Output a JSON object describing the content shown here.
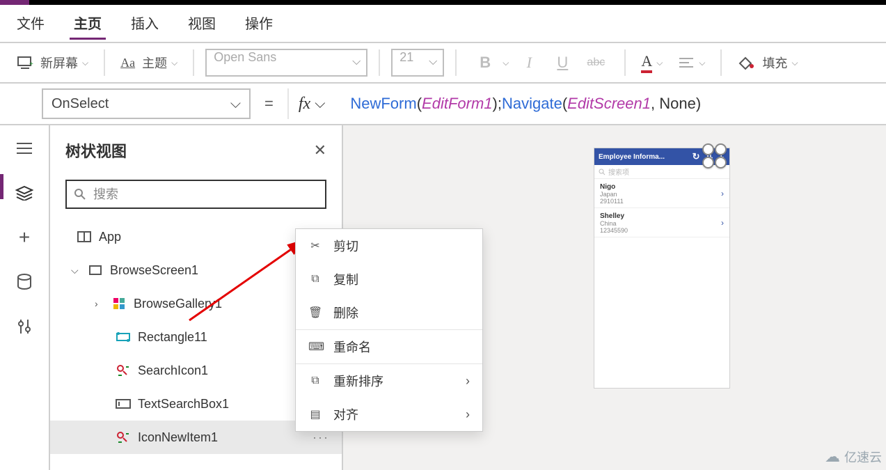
{
  "menubar": {
    "file": "文件",
    "home": "主页",
    "insert": "插入",
    "view": "视图",
    "action": "操作"
  },
  "toolbar": {
    "new_screen": "新屏幕",
    "theme": "主题",
    "font": "Open Sans",
    "font_size": "21",
    "fill": "填充"
  },
  "formula": {
    "property": "OnSelect",
    "tokens": {
      "newform": "NewForm",
      "editform1": "EditForm1",
      "navigate": "Navigate",
      "editscreen1": "EditScreen1",
      "none": "None"
    }
  },
  "tree": {
    "title": "树状视图",
    "search_ph": "搜索",
    "app": "App",
    "browse_screen": "BrowseScreen1",
    "browse_gallery": "BrowseGallery1",
    "rectangle": "Rectangle11",
    "search_icon": "SearchIcon1",
    "text_search": "TextSearchBox1",
    "icon_new": "IconNewItem1"
  },
  "context_menu": {
    "cut": "剪切",
    "copy": "复制",
    "delete": "删除",
    "rename": "重命名",
    "reorder": "重新排序",
    "align": "对齐"
  },
  "phone": {
    "title": "Employee Informa...",
    "search_ph": "搜索项",
    "rec1": {
      "name": "Nigo",
      "country": "Japan",
      "num": "2910111"
    },
    "rec2": {
      "name": "Shelley",
      "country": "China",
      "num": "12345590"
    }
  },
  "watermark": "亿速云"
}
